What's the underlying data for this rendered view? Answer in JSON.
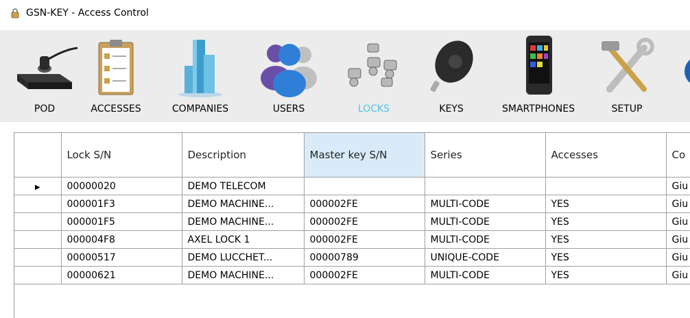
{
  "window": {
    "title": "GSN-KEY - Access Control"
  },
  "toolbar": {
    "buttons": [
      {
        "label": "POD",
        "icon": "pod-icon"
      },
      {
        "label": "ACCESSES",
        "icon": "clipboard-lock-icon"
      },
      {
        "label": "COMPANIES",
        "icon": "building-icon"
      },
      {
        "label": "USERS",
        "icon": "users-icon"
      },
      {
        "label": "LOCKS",
        "icon": "locks-icon",
        "active": true
      },
      {
        "label": "KEYS",
        "icon": "key-fob-icon"
      },
      {
        "label": "SMARTPHONES",
        "icon": "smartphone-icon"
      },
      {
        "label": "SETUP",
        "icon": "tools-icon"
      }
    ],
    "active_color": "#4fc3e6"
  },
  "grid": {
    "columns": [
      "Lock S/N",
      "Description",
      "Master key S/N",
      "Series",
      "Accesses",
      "Co"
    ],
    "current_row_marker": "▶",
    "rows": [
      [
        "00000020",
        "DEMO TELECOM",
        "",
        "",
        "",
        "Giu"
      ],
      [
        "000001F3",
        "DEMO MACHINE...",
        "000002FE",
        "MULTI-CODE",
        "YES",
        "Giu"
      ],
      [
        "000001F5",
        "DEMO MACHINE...",
        "000002FE",
        "MULTI-CODE",
        "YES",
        "Giu"
      ],
      [
        "000004F8",
        "AXEL LOCK 1",
        "000002FE",
        "MULTI-CODE",
        "YES",
        "Giu"
      ],
      [
        "00000517",
        "DEMO LUCCHET...",
        "00000789",
        "UNIQUE-CODE",
        "YES",
        "Giu"
      ],
      [
        "00000621",
        "DEMO MACHINE...",
        "000002FE",
        "MULTI-CODE",
        "YES",
        "Giu"
      ]
    ]
  }
}
